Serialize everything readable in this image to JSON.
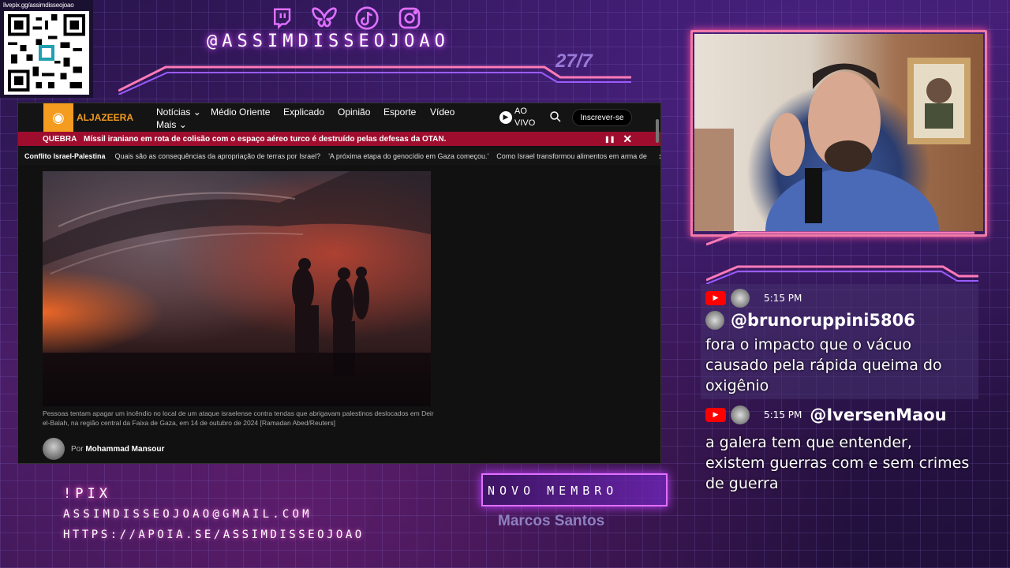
{
  "overlay": {
    "qr_url": "livepix.gg/assimdisseojoao",
    "handle": "@ASSIMDISSEOJOAO",
    "date": "27/7",
    "pix_label": "!PIX",
    "email": "ASSIMDISSEOJOAO@GMAIL.COM",
    "apoia_url": "HTTPS://APOIA.SE/ASSIMDISSEOJOAO",
    "new_member_label": "NOVO MEMBRO",
    "new_member_name": "Marcos Santos",
    "social_icons": [
      "twitch-icon",
      "bluesky-icon",
      "tiktok-icon",
      "instagram-icon"
    ],
    "accent_color": "#e070ff",
    "neon_pink": "#ff4fa0"
  },
  "browser": {
    "brand": "ALJAZEERA",
    "nav": {
      "noticias": "Notícias",
      "mais": "Mais",
      "medio_oriente": "Médio Oriente",
      "explicado": "Explicado",
      "opiniao": "Opinião",
      "esporte": "Esporte",
      "video": "Vídeo"
    },
    "live_line1": "AO",
    "live_line2": "VIVO",
    "subscribe": "Inscrever-se",
    "breaking_label": "QUEBRA",
    "breaking_text": "Míssil iraniano em rota de colisão com o espaço aéreo turco é destruído pelas defesas da OTAN.",
    "topics": {
      "label": "Conflito Israel-Palestina",
      "items": [
        "Quais são as consequências da apropriação de terras por Israel?",
        "'A próxima etapa do genocídio em Gaza começou.'",
        "Como Israel transformou alimentos em arma de"
      ]
    },
    "caption": "Pessoas tentam apagar um incêndio no local de um ataque israelense contra tendas que abrigavam palestinos deslocados em Deir el-Balah, na região central da Faixa de Gaza, em 14 de outubro de 2024 [Ramadan Abed/Reuters]",
    "author_prefix": "Por",
    "author_name": "Mohammad Mansour",
    "brand_color": "#f39c1f",
    "breaking_color": "#9e0d2e"
  },
  "chat": {
    "messages": [
      {
        "time": "5:15 PM",
        "username": "@brunoruppini5806",
        "text": "fora o impacto que o vácuo causado pela rápida queima do oxigênio"
      },
      {
        "time": "5:15 PM",
        "username": "@IversenMaou",
        "text": "a galera tem que entender, existem guerras com e sem crimes de guerra"
      }
    ]
  }
}
